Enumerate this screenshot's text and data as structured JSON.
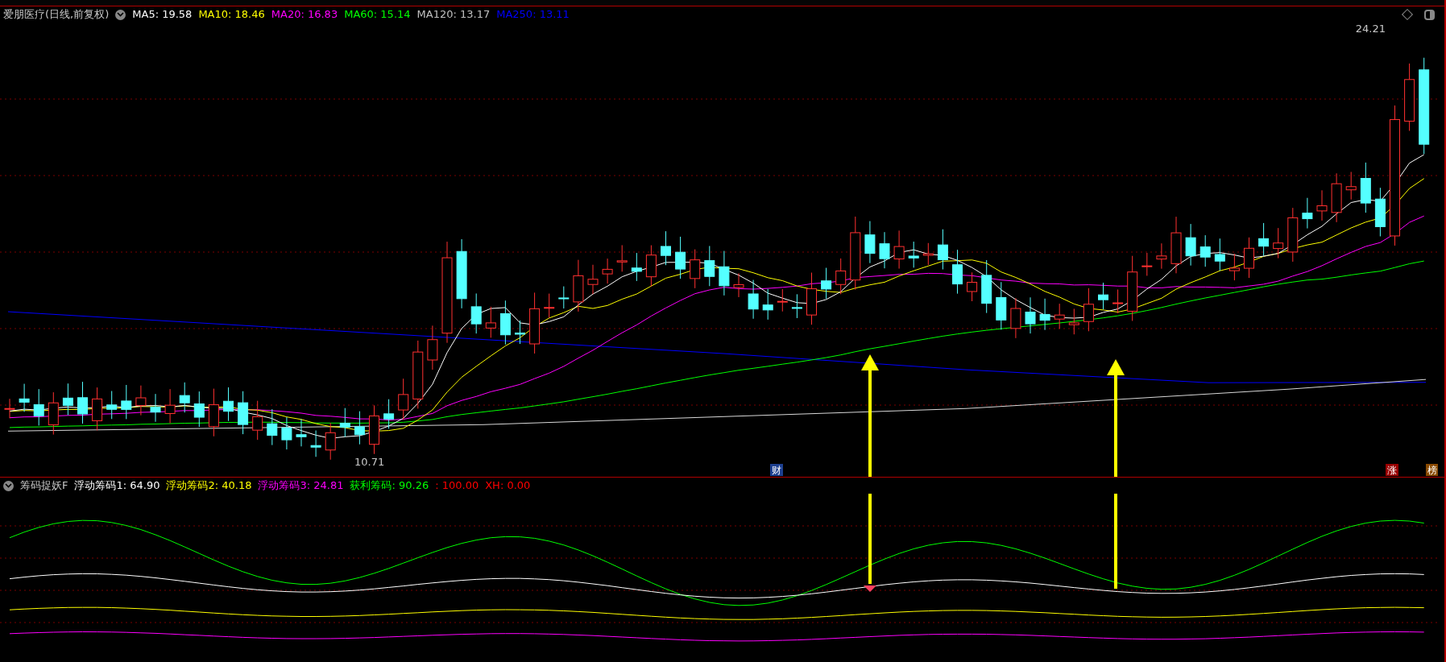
{
  "chart": {
    "title": "爱朋医疗(日线,前复权)",
    "ma": [
      {
        "label": "MA5: 19.58",
        "color": "#ffffff"
      },
      {
        "label": "MA10: 18.46",
        "color": "#ffff00"
      },
      {
        "label": "MA20: 16.83",
        "color": "#ff00ff"
      },
      {
        "label": "MA60: 15.14",
        "color": "#00ff00"
      },
      {
        "label": "MA120: 13.17",
        "color": "#c0c0c0"
      },
      {
        "label": "MA250: 13.11",
        "color": "#0000ff"
      }
    ],
    "high_label": "24.21",
    "low_label": "10.71",
    "markers": [
      {
        "text": "财",
        "color": "#1d3f8f"
      },
      {
        "text": "涨",
        "color": "#990000"
      },
      {
        "text": "榜",
        "color": "#8a4a00"
      }
    ]
  },
  "indicator": {
    "title": "筹码捉妖F",
    "values": [
      {
        "label": "浮动筹码1: 64.90",
        "color": "#ffffff"
      },
      {
        "label": "浮动筹码2: 40.18",
        "color": "#ffff00"
      },
      {
        "label": "浮动筹码3: 24.81",
        "color": "#ff00ff"
      },
      {
        "label": "获利筹码: 90.26",
        "color": "#00ff00"
      },
      {
        "label": ": 100.00",
        "color": "#ff0000"
      },
      {
        "label": "XH: 0.00",
        "color": "#ff0000"
      }
    ]
  }
}
